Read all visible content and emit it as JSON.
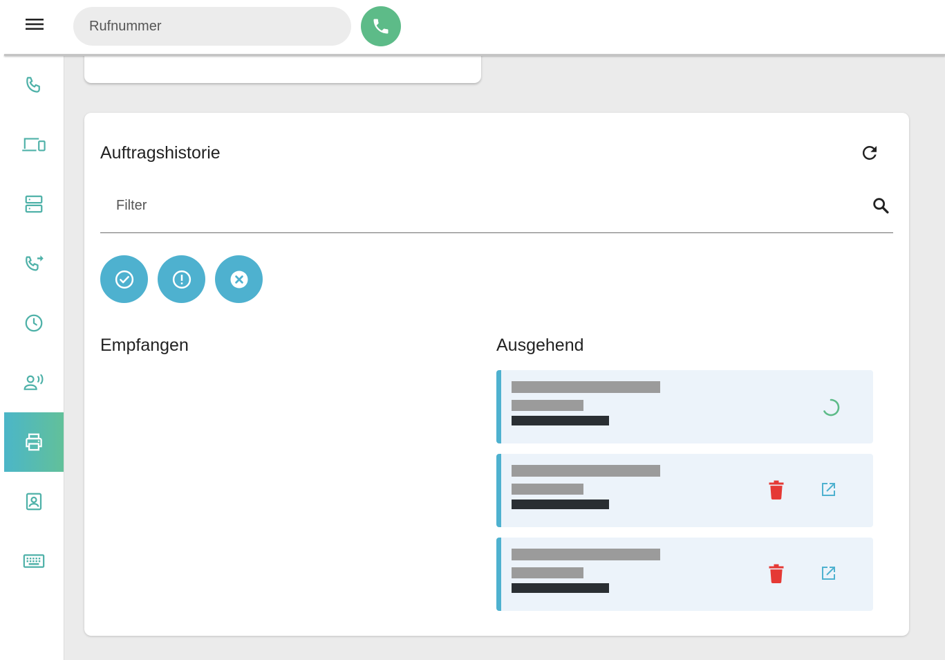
{
  "header": {
    "phone_placeholder": "Rufnummer",
    "icons": {
      "menu": "menu-icon",
      "call": "phone-icon"
    },
    "call_button_color": "#5dbb88"
  },
  "sidebar": {
    "active_index": 6,
    "items": [
      {
        "name": "phone",
        "icon": "phone-icon"
      },
      {
        "name": "devices",
        "icon": "devices-icon"
      },
      {
        "name": "server",
        "icon": "server-icon"
      },
      {
        "name": "call-forward",
        "icon": "phone-forward-icon"
      },
      {
        "name": "history",
        "icon": "clock-icon"
      },
      {
        "name": "voice",
        "icon": "user-voice-icon"
      },
      {
        "name": "print",
        "icon": "printer-icon"
      },
      {
        "name": "contact",
        "icon": "contact-card-icon"
      },
      {
        "name": "keyboard",
        "icon": "keyboard-icon"
      }
    ],
    "active_gradient": [
      "#4bb6c8",
      "#62c09a"
    ]
  },
  "history": {
    "title": "Auftragshistorie",
    "filter_placeholder": "Filter",
    "status_filters": [
      {
        "name": "success",
        "icon": "check-circle-icon"
      },
      {
        "name": "warning",
        "icon": "alert-circle-icon"
      },
      {
        "name": "error",
        "icon": "close-circle-icon"
      }
    ],
    "accent_color": "#4eb1cf",
    "received": {
      "title": "Empfangen",
      "items": []
    },
    "outgoing": {
      "title": "Ausgehend",
      "items": [
        {
          "status": "pending",
          "actions": [
            "spinner-icon"
          ]
        },
        {
          "status": "done",
          "actions": [
            "trash-icon",
            "open-external-icon"
          ]
        },
        {
          "status": "done",
          "actions": [
            "trash-icon",
            "open-external-icon"
          ]
        }
      ]
    }
  }
}
